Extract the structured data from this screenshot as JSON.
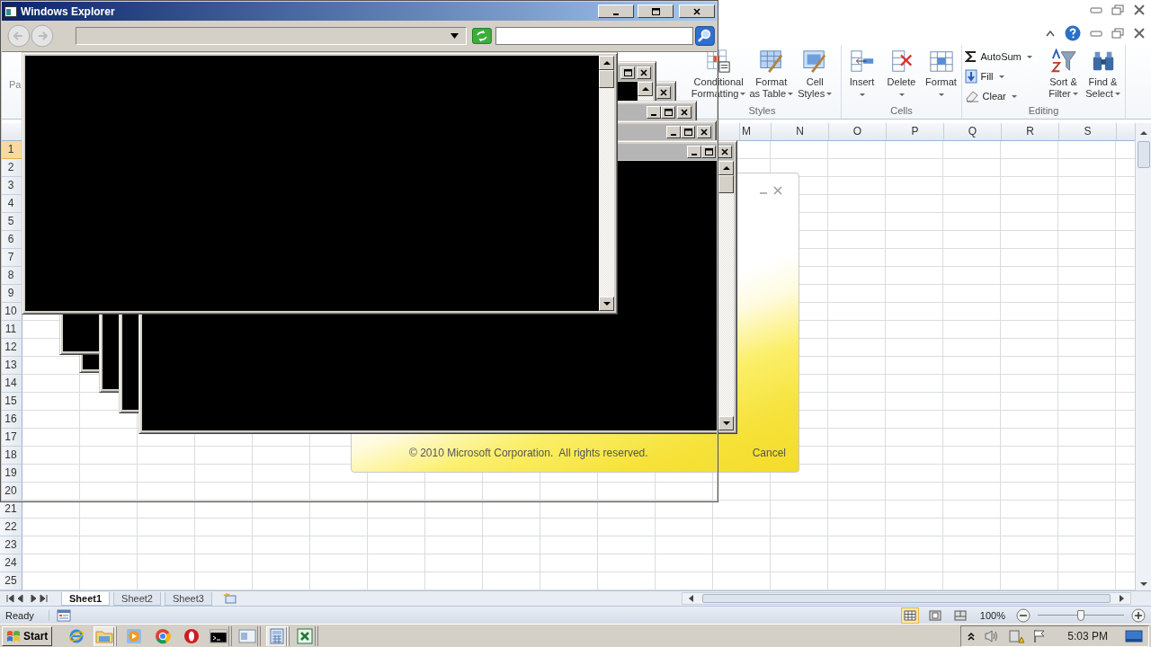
{
  "explorer": {
    "title": "Windows Explorer"
  },
  "excel": {
    "clipboard_label": "Pa",
    "ribbon_groups": [
      {
        "label": "Styles",
        "commands": [
          {
            "lines": [
              "Conditional",
              "Formatting"
            ]
          },
          {
            "lines": [
              "Format",
              "as Table"
            ]
          },
          {
            "lines": [
              "Cell",
              "Styles"
            ]
          }
        ]
      },
      {
        "label": "Cells",
        "commands": [
          {
            "lines": [
              "Insert"
            ]
          },
          {
            "lines": [
              "Delete"
            ]
          },
          {
            "lines": [
              "Format"
            ]
          }
        ]
      },
      {
        "label": "Editing",
        "small_commands": [
          {
            "label": "AutoSum"
          },
          {
            "label": "Fill"
          },
          {
            "label": "Clear"
          }
        ],
        "commands": [
          {
            "lines": [
              "Sort &",
              "Filter"
            ]
          },
          {
            "lines": [
              "Find &",
              "Select"
            ]
          }
        ]
      }
    ],
    "columns": [
      "M",
      "N",
      "O",
      "P",
      "Q",
      "R",
      "S"
    ],
    "rows": [
      {
        "label": "1",
        "selected": true
      },
      {
        "label": "2",
        "selected": false
      },
      {
        "label": "3",
        "selected": false
      },
      {
        "label": "4",
        "selected": false
      },
      {
        "label": "5",
        "selected": false
      },
      {
        "label": "6",
        "selected": false
      },
      {
        "label": "7",
        "selected": false
      },
      {
        "label": "8",
        "selected": false
      },
      {
        "label": "9",
        "selected": false
      },
      {
        "label": "10",
        "selected": false
      },
      {
        "label": "11",
        "selected": false
      },
      {
        "label": "12",
        "selected": false
      },
      {
        "label": "13",
        "selected": false
      },
      {
        "label": "14",
        "selected": false
      },
      {
        "label": "15",
        "selected": false
      },
      {
        "label": "16",
        "selected": false
      },
      {
        "label": "17",
        "selected": false
      },
      {
        "label": "18",
        "selected": false
      },
      {
        "label": "19",
        "selected": false
      },
      {
        "label": "20",
        "selected": false
      },
      {
        "label": "21",
        "selected": false
      },
      {
        "label": "22",
        "selected": false
      },
      {
        "label": "23",
        "selected": false
      },
      {
        "label": "24",
        "selected": false
      },
      {
        "label": "25",
        "selected": false
      }
    ],
    "sheet_tabs": [
      {
        "label": "Sheet1",
        "selected": true
      },
      {
        "label": "Sheet2",
        "selected": false
      },
      {
        "label": "Sheet3",
        "selected": false
      }
    ],
    "status": "Ready",
    "view_buttons": [
      {
        "selected": true
      },
      {
        "selected": false
      },
      {
        "selected": false
      }
    ],
    "zoom": {
      "reading": "100%",
      "level": 0.5
    }
  },
  "splash": {
    "copyright": "© 2010 Microsoft Corporation.  All rights reserved.",
    "cancel": "Cancel"
  },
  "taskbar": {
    "start": "Start",
    "buttons": [
      {
        "kind": "launcher",
        "active": false
      },
      {
        "kind": "task",
        "active": true
      },
      {
        "kind": "launcher",
        "active": false
      },
      {
        "kind": "launcher",
        "active": false
      },
      {
        "kind": "launcher",
        "active": false
      },
      {
        "kind": "task",
        "active": false
      },
      {
        "kind": "task",
        "active": false
      },
      {
        "kind": "task",
        "active": true
      },
      {
        "kind": "task",
        "active": false
      }
    ],
    "clock": "5:03 PM"
  }
}
